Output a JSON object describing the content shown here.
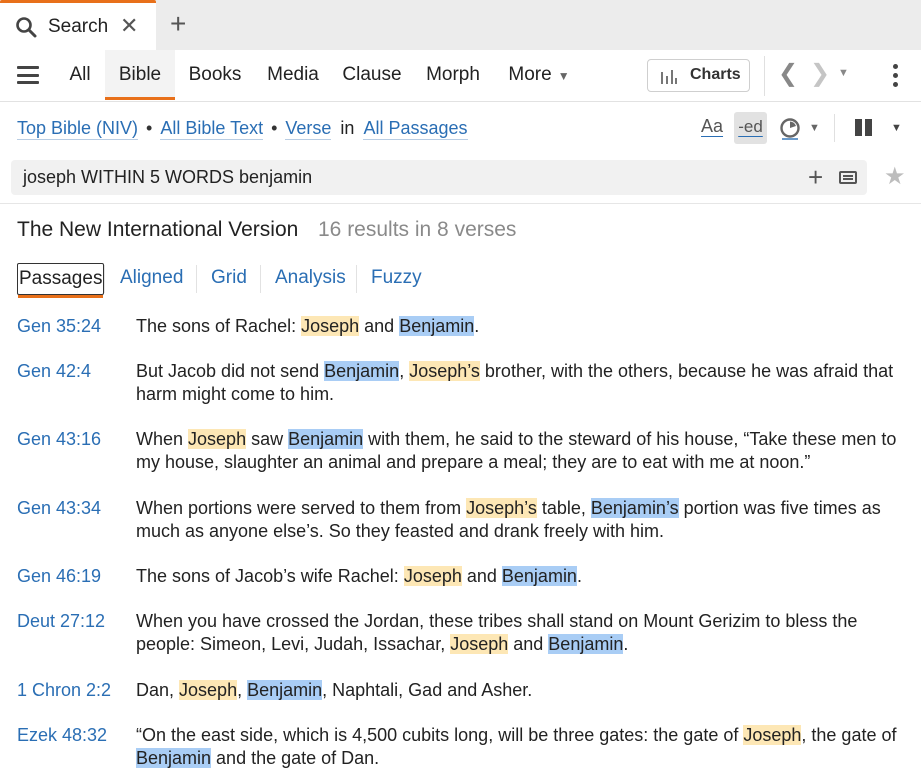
{
  "tab": {
    "icon": "search-icon",
    "title": "Search",
    "close_icon": "close-icon"
  },
  "new_tab_icon": "plus-icon",
  "toolbar": {
    "tabs": [
      {
        "label": "All"
      },
      {
        "label": "Bible",
        "active": true
      },
      {
        "label": "Books"
      },
      {
        "label": "Media"
      },
      {
        "label": "Clause"
      },
      {
        "label": "Morph"
      },
      {
        "label": "More"
      }
    ],
    "charts_label": "Charts"
  },
  "options": {
    "bible": "Top Bible (NIV)",
    "scope": "All Bible Text",
    "unit": "Verse",
    "in": "in",
    "range": "All Passages",
    "aa": "Aa",
    "ed": "-ed"
  },
  "search": {
    "query": "joseph WITHIN 5 WORDS benjamin"
  },
  "results": {
    "version": "The New International Version",
    "count": "16 results in 8 verses",
    "subtabs": [
      "Passages",
      "Aligned",
      "Grid",
      "Analysis",
      "Fuzzy"
    ],
    "verses": [
      {
        "ref": "Gen 35:24",
        "parts": [
          {
            "t": "The sons of Rachel: "
          },
          {
            "t": "Joseph",
            "h": "j"
          },
          {
            "t": " and "
          },
          {
            "t": "Benjamin",
            "h": "b"
          },
          {
            "t": "."
          }
        ]
      },
      {
        "ref": "Gen 42:4",
        "parts": [
          {
            "t": "But Jacob did not send "
          },
          {
            "t": "Benjamin",
            "h": "b"
          },
          {
            "t": ", "
          },
          {
            "t": "Joseph’s",
            "h": "j"
          },
          {
            "t": " brother, with the others, because he was afraid that harm might come to him."
          }
        ]
      },
      {
        "ref": "Gen 43:16",
        "parts": [
          {
            "t": "When "
          },
          {
            "t": "Joseph",
            "h": "j"
          },
          {
            "t": " saw "
          },
          {
            "t": "Benjamin",
            "h": "b"
          },
          {
            "t": " with them, he said to the steward of his house, “Take these men to my house, slaughter an animal and prepare a meal; they are to eat with me at noon.”"
          }
        ]
      },
      {
        "ref": "Gen 43:34",
        "parts": [
          {
            "t": "When portions were served to them from "
          },
          {
            "t": "Joseph’s",
            "h": "j"
          },
          {
            "t": " table, "
          },
          {
            "t": "Benjamin’s",
            "h": "b"
          },
          {
            "t": " portion was five times as much as anyone else’s. So they feasted and drank freely with him."
          }
        ]
      },
      {
        "ref": "Gen 46:19",
        "parts": [
          {
            "t": "The sons of Jacob’s wife Rachel: "
          },
          {
            "t": "Joseph",
            "h": "j"
          },
          {
            "t": " and "
          },
          {
            "t": "Benjamin",
            "h": "b"
          },
          {
            "t": "."
          }
        ]
      },
      {
        "ref": "Deut 27:12",
        "parts": [
          {
            "t": "When you have crossed the Jordan, these tribes shall stand on Mount Gerizim to bless the people: Simeon, Levi, Judah, Issachar, "
          },
          {
            "t": "Joseph",
            "h": "j"
          },
          {
            "t": " and "
          },
          {
            "t": "Benjamin",
            "h": "b"
          },
          {
            "t": "."
          }
        ]
      },
      {
        "ref": "1 Chron 2:2",
        "parts": [
          {
            "t": "Dan, "
          },
          {
            "t": "Joseph",
            "h": "j"
          },
          {
            "t": ", "
          },
          {
            "t": "Benjamin",
            "h": "b"
          },
          {
            "t": ", Naphtali, Gad and Asher."
          }
        ]
      },
      {
        "ref": "Ezek 48:32",
        "parts": [
          {
            "t": "“On the east side, which is 4,500 cubits long, will be three gates: the gate of "
          },
          {
            "t": "Joseph",
            "h": "j"
          },
          {
            "t": ", the gate of "
          },
          {
            "t": "Benjamin",
            "h": "b"
          },
          {
            "t": " and the gate of Dan."
          }
        ]
      }
    ]
  },
  "colors": {
    "accent": "#e8701a",
    "link": "#2a6eb4",
    "highlight_joseph": "#fde7b5",
    "highlight_benjamin": "#a9cdf5"
  }
}
